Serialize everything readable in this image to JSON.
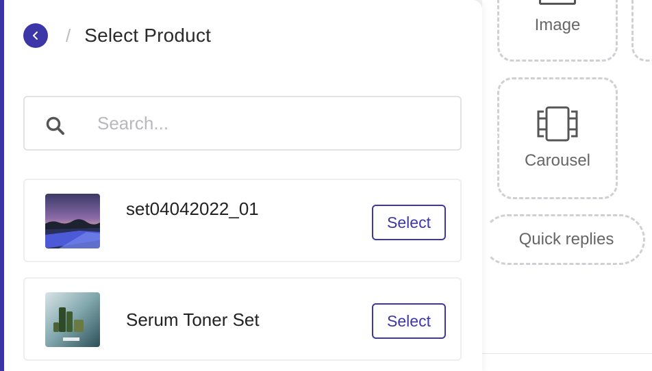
{
  "header": {
    "back_icon": "chevron-left-icon",
    "separator": "/",
    "title": "Select Product"
  },
  "search": {
    "icon": "search-icon",
    "placeholder": "Search...",
    "value": ""
  },
  "products": [
    {
      "name": "set04042022_01",
      "action_label": "Select",
      "thumb": "landscape-night-sky"
    },
    {
      "name": "Serum Toner Set",
      "action_label": "Select",
      "thumb": "skincare-bottles"
    }
  ],
  "canvas": {
    "tiles": [
      {
        "label": "Image",
        "icon": "image-icon"
      },
      {
        "label": "Carousel",
        "icon": "carousel-icon"
      },
      {
        "label": "Quick replies",
        "icon": ""
      }
    ]
  },
  "colors": {
    "accent": "#3d36a8",
    "text": "#222222",
    "muted": "#b8b8bd",
    "tile_border": "#cfcfd4"
  }
}
